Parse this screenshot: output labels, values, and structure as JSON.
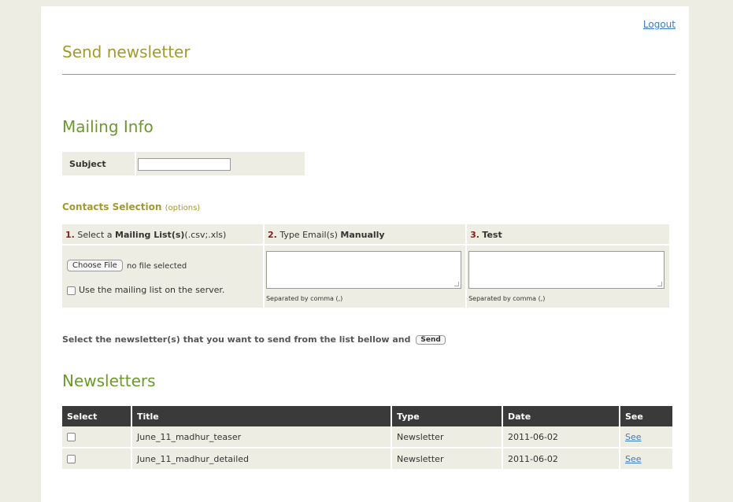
{
  "header": {
    "logout_label": "Logout",
    "page_title": "Send newsletter"
  },
  "mailing_info": {
    "title": "Mailing Info",
    "subject_label": "Subject",
    "subject_value": ""
  },
  "contacts": {
    "title": "Contacts Selection",
    "options_label": "(options)",
    "col1": {
      "num": "1.",
      "pre": "Select a ",
      "bold": "Mailing List(s)",
      "post": "(.csv;.xls)"
    },
    "col2": {
      "num": "2.",
      "pre": "Type Email(s) ",
      "bold": "Manually"
    },
    "col3": {
      "num": "3.",
      "bold": "Test"
    },
    "choose_file_label": "Choose File",
    "no_file_text": "no file selected",
    "use_server_label": "Use the mailing list on the server.",
    "separated_note_manual": "Separated by comma (,)",
    "separated_note_test": "Separated by comma (,)"
  },
  "send": {
    "instruction": "Select the newsletter(s) that you want to send from the list bellow and",
    "button_label": "Send"
  },
  "newsletters": {
    "title": "Newsletters",
    "columns": [
      "Select",
      "Title",
      "Type",
      "Date",
      "See"
    ],
    "rows": [
      {
        "title": "June_11_madhur_teaser",
        "type": "Newsletter",
        "date": "2011-06-02",
        "see": "See"
      },
      {
        "title": "June_11_madhur_detailed",
        "type": "Newsletter",
        "date": "2011-06-02",
        "see": "See"
      }
    ]
  }
}
